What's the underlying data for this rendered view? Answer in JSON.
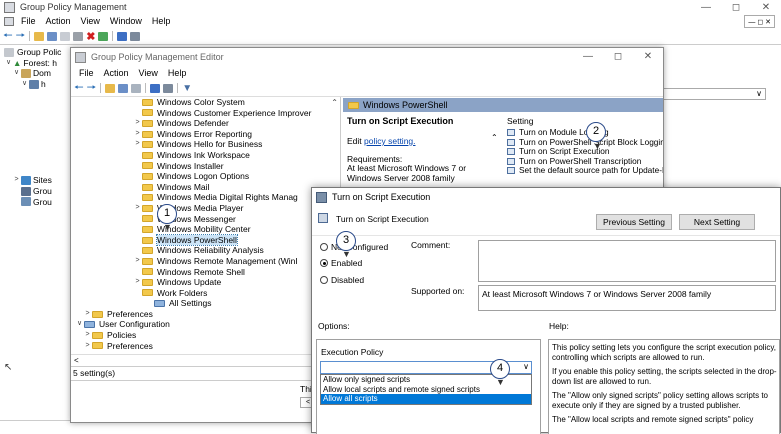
{
  "gpm": {
    "title": "Group Policy Management",
    "menu": [
      "File",
      "Action",
      "View",
      "Window",
      "Help"
    ],
    "tree": [
      "Group Polic",
      "Forest: h",
      "Dom",
      "h",
      "Sites",
      "Grou",
      "Grou"
    ]
  },
  "editor": {
    "title": "Group Policy Management Editor",
    "menu": [
      "File",
      "Action",
      "View",
      "Help"
    ],
    "tree": [
      {
        "label": "Windows Color System",
        "expandable": false
      },
      {
        "label": "Windows Customer Experience Improver",
        "expandable": false
      },
      {
        "label": "Windows Defender",
        "expandable": true
      },
      {
        "label": "Windows Error Reporting",
        "expandable": true
      },
      {
        "label": "Windows Hello for Business",
        "expandable": true
      },
      {
        "label": "Windows Ink Workspace",
        "expandable": false
      },
      {
        "label": "Windows Installer",
        "expandable": false
      },
      {
        "label": "Windows Logon Options",
        "expandable": false
      },
      {
        "label": "Windows Mail",
        "expandable": false
      },
      {
        "label": "Windows Media Digital Rights Manag",
        "expandable": false
      },
      {
        "label": "Windows Media Player",
        "expandable": true
      },
      {
        "label": "Windows Messenger",
        "expandable": false
      },
      {
        "label": "Windows Mobility Center",
        "expandable": false
      },
      {
        "label": "Windows PowerShell",
        "expandable": false,
        "selected": true
      },
      {
        "label": "Windows Reliability Analysis",
        "expandable": false
      },
      {
        "label": "Windows Remote Management (WinI",
        "expandable": true
      },
      {
        "label": "Windows Remote Shell",
        "expandable": false
      },
      {
        "label": "Windows Update",
        "expandable": true
      },
      {
        "label": "Work Folders",
        "expandable": false
      }
    ],
    "all_settings": "All Settings",
    "preferences_1": "Preferences",
    "user_configuration": "User Configuration",
    "policies": "Policies",
    "preferences_2": "Preferences",
    "status": "5 setting(s)",
    "right_header": "Windows PowerShell",
    "setting_title": "Turn on Script Execution",
    "edit_prefix": "Edit ",
    "edit_link": "policy setting.",
    "requirements_label": "Requirements:",
    "requirements_text": "At least Microsoft Windows 7 or Windows Server 2008 family",
    "setting_col": "Setting",
    "settings": [
      "Turn on Module Logging",
      "Turn on PowerShell Script Block Logging",
      "Turn on Script Execution",
      "Turn on PowerShell Transcription",
      "Set the default source path for Update-Help"
    ],
    "bottom_text": "This"
  },
  "dialog": {
    "title": "Turn on Script Execution",
    "heading": "Turn on Script Execution",
    "previous_button": "Previous Setting",
    "next_button": "Next Setting",
    "radio_not_configured": "Not Configured",
    "radio_enabled": "Enabled",
    "radio_disabled": "Disabled",
    "comment_label": "Comment:",
    "supported_label": "Supported on:",
    "supported_text": "At least Microsoft Windows 7 or Windows Server 2008 family",
    "options_label": "Options:",
    "help_label": "Help:",
    "execution_policy_label": "Execution Policy",
    "dropdown_options": [
      "Allow only signed scripts",
      "Allow local scripts and remote signed scripts",
      "Allow all scripts"
    ],
    "help_paragraphs": [
      "This policy setting lets you configure the script execution policy, controlling which scripts are allowed to run.",
      "If you enable this policy setting, the scripts selected in the drop-down list are allowed to run.",
      "The \"Allow only signed scripts\" policy setting allows scripts to execute only if they are signed by a trusted publisher.",
      "The \"Allow local scripts and remote signed scripts\" policy"
    ]
  },
  "callouts": [
    "1",
    "2",
    "3",
    "4"
  ]
}
